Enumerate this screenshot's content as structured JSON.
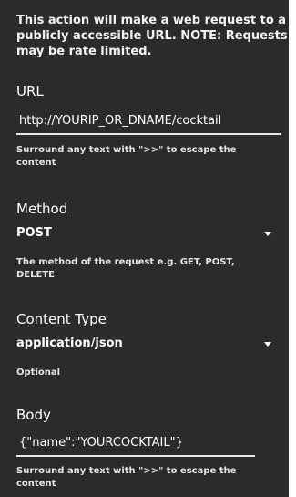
{
  "description": "This action will make a web request to a publicly accessible URL. NOTE: Requests may be rate limited.",
  "url": {
    "title": "URL",
    "value": "http://YOURIP_OR_DNAME/cocktail",
    "help": "Surround any text with \">>\" to escape the content"
  },
  "method": {
    "title": "Method",
    "selected": "POST",
    "help": "The method of the request e.g. GET, POST, DELETE"
  },
  "content_type": {
    "title": "Content Type",
    "selected": "application/json",
    "help": "Optional"
  },
  "body": {
    "title": "Body",
    "value": "{\"name\":\"YOURCOCKTAIL\"}",
    "help": "Surround any text with \">>\" to escape the content"
  },
  "colors": {
    "panel_background": "#2b2b2b",
    "text": "#ffffff",
    "underline": "#e9e9e9"
  }
}
